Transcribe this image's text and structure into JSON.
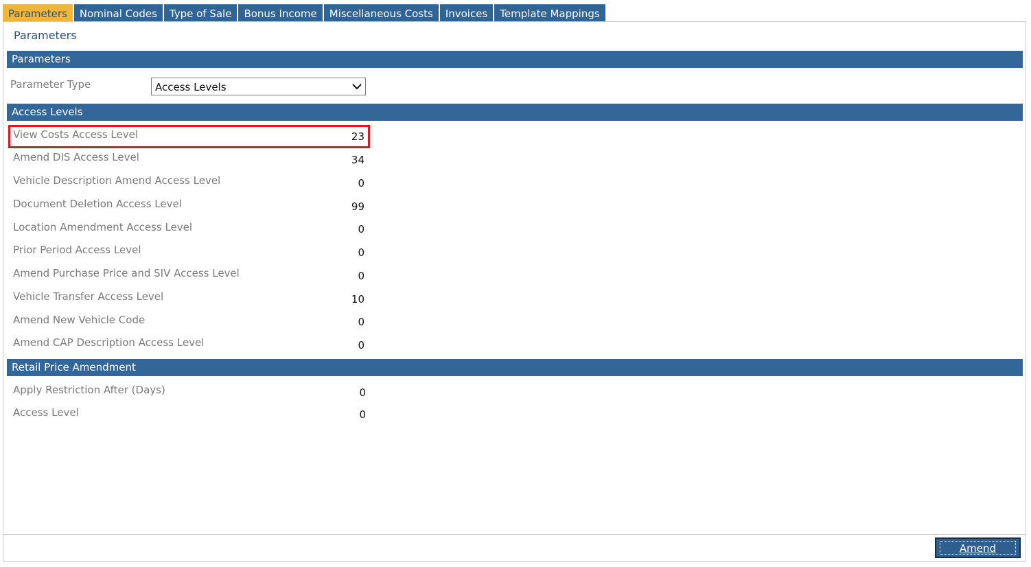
{
  "tabs": [
    {
      "label": "Parameters",
      "active": true
    },
    {
      "label": "Nominal Codes",
      "active": false
    },
    {
      "label": "Type of Sale",
      "active": false
    },
    {
      "label": "Bonus Income",
      "active": false
    },
    {
      "label": "Miscellaneous Costs",
      "active": false
    },
    {
      "label": "Invoices",
      "active": false
    },
    {
      "label": "Template Mappings",
      "active": false
    }
  ],
  "page_title": "Parameters",
  "sections": {
    "parameters": {
      "title": "Parameters",
      "parameter_type_label": "Parameter Type",
      "parameter_type_value": "Access Levels"
    },
    "access_levels": {
      "title": "Access Levels",
      "fields": [
        {
          "label": "View Costs Access Level",
          "value": "23"
        },
        {
          "label": "Amend DIS Access Level",
          "value": "34"
        },
        {
          "label": "Vehicle Description Amend Access Level",
          "value": "0"
        },
        {
          "label": "Document Deletion Access Level",
          "value": "99"
        },
        {
          "label": "Location Amendment Access Level",
          "value": "0"
        },
        {
          "label": "Prior Period Access Level",
          "value": "0"
        },
        {
          "label": "Amend Purchase Price and SIV Access Level",
          "value": "0"
        },
        {
          "label": "Vehicle Transfer Access Level",
          "value": "10"
        },
        {
          "label": "Amend New Vehicle Code",
          "value": "0"
        },
        {
          "label": "Amend CAP Description Access Level",
          "value": "0"
        }
      ]
    },
    "retail_price_amendment": {
      "title": "Retail Price Amendment",
      "fields": [
        {
          "label": "Apply Restriction After (Days)",
          "value": "0"
        },
        {
          "label": "Access Level",
          "value": "0"
        }
      ]
    }
  },
  "footer": {
    "amend_label": "Amend"
  },
  "colors": {
    "section_bar": "#336699",
    "active_tab": "#f2b637",
    "highlight_border": "#e8141b"
  }
}
